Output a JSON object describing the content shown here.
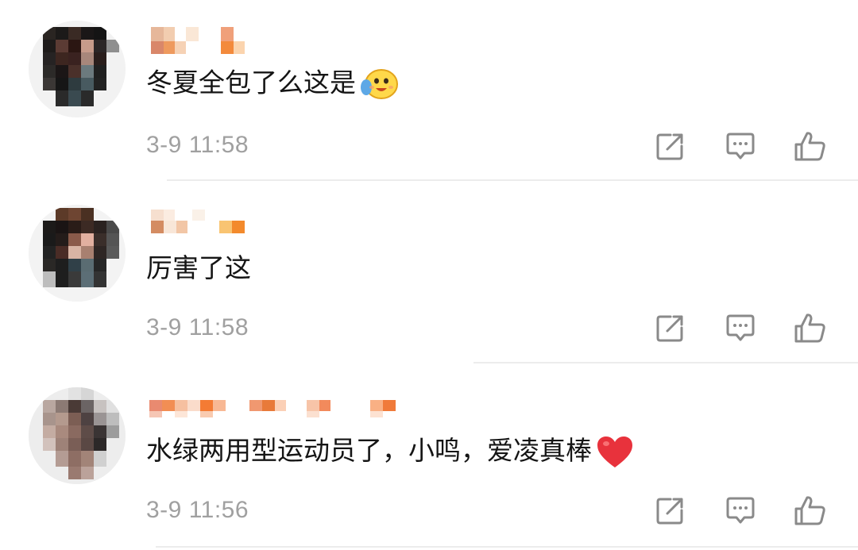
{
  "comments": [
    {
      "text": "冬夏全包了么这是",
      "emoji": "smiling-face-icon",
      "time": "3-9 11:58"
    },
    {
      "text": "厉害了这",
      "emoji": "",
      "time": "3-9 11:58"
    },
    {
      "text": "水绿两用型运动员了，小鸣，爱凌真棒",
      "emoji": "red-heart-icon",
      "time": "3-9 11:56"
    }
  ],
  "actions": [
    "share-icon",
    "reply-icon",
    "like-icon"
  ],
  "colors": {
    "text": "#151515",
    "meta": "#a0a0a0",
    "icon": "#8a8a8a",
    "divider": "#ececec",
    "heart": "#e8323c"
  }
}
